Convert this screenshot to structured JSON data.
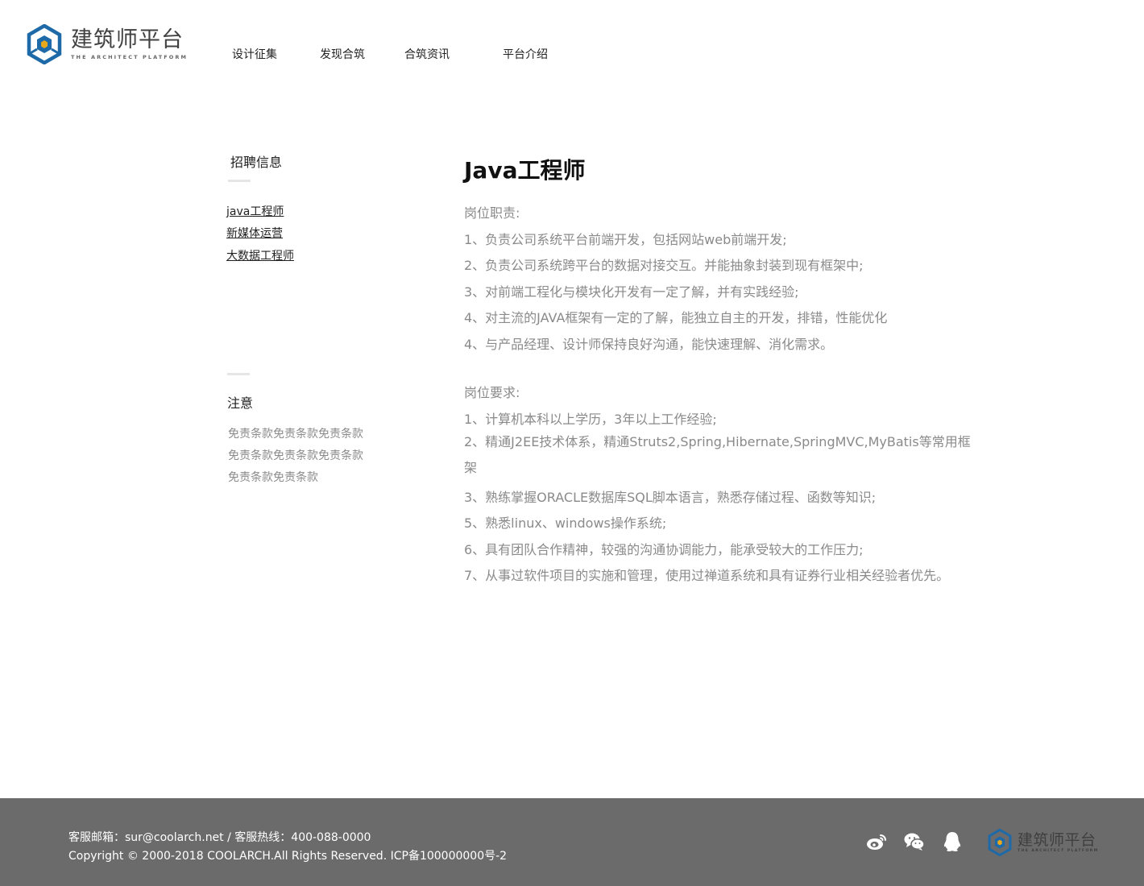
{
  "brand": {
    "name": "建筑师平台",
    "subtitle": "THE ARCHITECT PLATFORM",
    "primary_color": "#1e6aa8",
    "accent_color": "#e8a81c"
  },
  "nav": {
    "items": [
      {
        "label": "设计征集"
      },
      {
        "label": "发现合筑"
      },
      {
        "label": "合筑资讯"
      },
      {
        "label": "平台介绍"
      }
    ]
  },
  "sidebar": {
    "title": "招聘信息",
    "links": [
      {
        "label": "java工程师"
      },
      {
        "label": "新媒体运营"
      },
      {
        "label": "大数据工程师"
      }
    ],
    "notice_title": "注意",
    "notice_lines": [
      "免责条款免责条款免责条款",
      "免责条款免责条款免责条款",
      "免责条款免责条款"
    ]
  },
  "job": {
    "title": "Java工程师",
    "duties_heading": "岗位职责:",
    "duties": [
      "1、负责公司系统平台前端开发，包括网站web前端开发;",
      "2、负责公司系统跨平台的数据对接交互。并能抽象封装到现有框架中;",
      "3、对前端工程化与模块化开发有一定了解，并有实践经验;",
      "4、对主流的JAVA框架有一定的了解，能独立自主的开发，排错，性能优化",
      "4、与产品经理、设计师保持良好沟通，能快速理解、消化需求。"
    ],
    "requirements_heading": "岗位要求:",
    "requirements": [
      "1、计算机本科以上学历，3年以上工作经验;",
      "2、精通J2EE技术体系，精通Struts2,Spring,Hibernate,SpringMVC,MyBatis等常用框架",
      "3、熟练掌握ORACLE数据库SQL脚本语言，熟悉存储过程、函数等知识;",
      "5、熟悉linux、windows操作系统;",
      "6、具有团队合作精神，较强的沟通协调能力，能承受较大的工作压力;",
      "7、从事过软件项目的实施和管理，使用过禅道系统和具有证券行业相关经验者优先。"
    ]
  },
  "footer": {
    "contact": "客服邮箱：sur@coolarch.net / 客服热线：400-088-0000",
    "copyright": "Copyright © 2000-2018 COOLARCH.All Rights Reserved.  ICP备100000000号-2",
    "social_icons": [
      "weibo-icon",
      "wechat-icon",
      "qq-icon"
    ],
    "brand_name": "建筑师平台",
    "brand_subtitle": "THE ARCHITECT PLATFORM",
    "background_color": "#6b6b6b"
  }
}
